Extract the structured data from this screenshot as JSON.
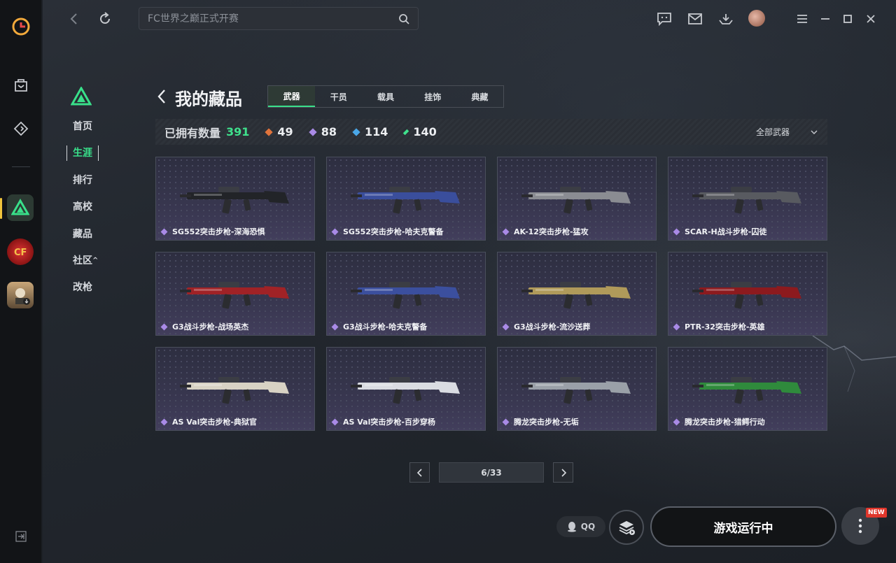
{
  "search": {
    "placeholder": "FC世界之巅正式开赛"
  },
  "subnav": {
    "items": [
      "首页",
      "生涯",
      "排行",
      "高校",
      "藏品",
      "社区",
      "改枪"
    ],
    "active_index": 1,
    "community_suffix": "^"
  },
  "page": {
    "title": "我的藏品",
    "tabs": [
      "武器",
      "干员",
      "载具",
      "挂饰",
      "典藏"
    ],
    "active_tab": 0
  },
  "stats": {
    "label": "已拥有数量",
    "total": "391",
    "rarities": [
      {
        "value": "49",
        "color": "#e0743c"
      },
      {
        "value": "88",
        "color": "#a98ae6"
      },
      {
        "value": "114",
        "color": "#4aa7e8"
      },
      {
        "value": "140",
        "color": "#3fe08c"
      }
    ],
    "filter_label": "全部武器"
  },
  "items": [
    {
      "name": "SG552突击步枪-深海恐惧",
      "gun_color": "#222428"
    },
    {
      "name": "SG552突击步枪-哈夫克警备",
      "gun_color": "#3a4e9c"
    },
    {
      "name": "AK-12突击步枪-猛攻",
      "gun_color": "#8a8c92"
    },
    {
      "name": "SCAR-H战斗步枪-囚徒",
      "gun_color": "#585a60"
    },
    {
      "name": "G3战斗步枪-战场英杰",
      "gun_color": "#a02226"
    },
    {
      "name": "G3战斗步枪-哈夫克警备",
      "gun_color": "#3b4f9e"
    },
    {
      "name": "G3战斗步枪-流沙送葬",
      "gun_color": "#b09a5a"
    },
    {
      "name": "PTR-32突击步枪-英雄",
      "gun_color": "#8c1a1e"
    },
    {
      "name": "AS Val突击步枪-典狱官",
      "gun_color": "#d8d2c4"
    },
    {
      "name": "AS Val突击步枪-百步穿杨",
      "gun_color": "#dadce2"
    },
    {
      "name": "腾龙突击步枪-无垢",
      "gun_color": "#9aa0a8"
    },
    {
      "name": "腾龙突击步枪-猎鳄行动",
      "gun_color": "#2f8a3c"
    }
  ],
  "pagination": {
    "label": "6/33"
  },
  "bottom": {
    "qq_label": "QQ",
    "launch_label": "游戏运行中",
    "new_badge": "NEW"
  },
  "colors": {
    "accent_green": "#39e08a"
  }
}
